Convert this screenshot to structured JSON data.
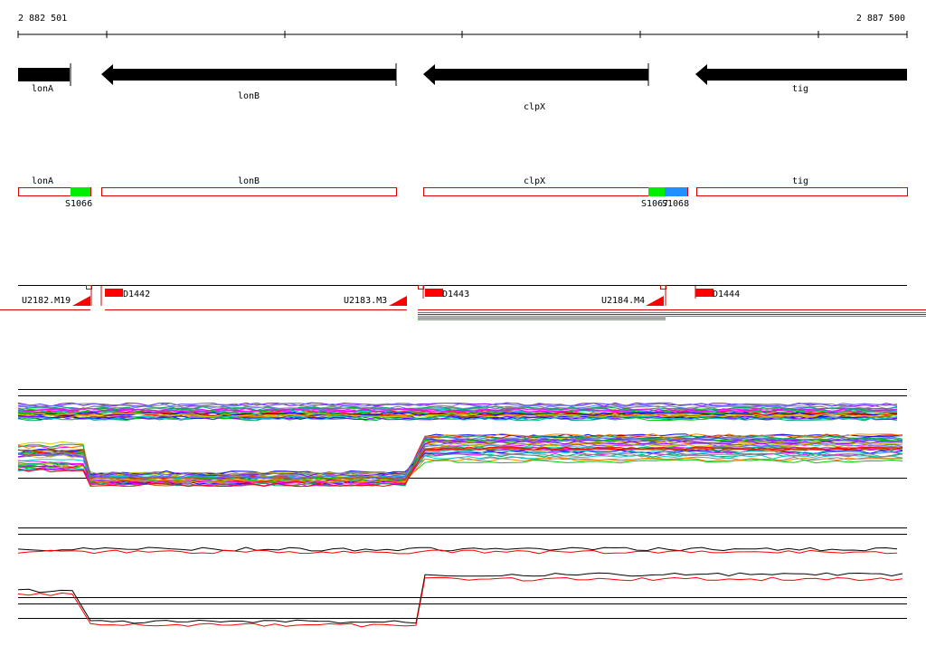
{
  "header": {
    "coord_start": "2 882 501",
    "coord_end": "2 887 500"
  },
  "genes": [
    {
      "name": "lonA"
    },
    {
      "name": "lonB"
    },
    {
      "name": "clpX"
    },
    {
      "name": "tig"
    }
  ],
  "features": [
    {
      "name": "S1066",
      "color": "#00ee00"
    },
    {
      "name": "S1067",
      "color": "#00ee00"
    },
    {
      "name": "S1068",
      "color": "#1e90ff"
    }
  ],
  "probes": [
    {
      "name": "U2182.M19"
    },
    {
      "name": "U2183.M3"
    },
    {
      "name": "U2184.M4"
    }
  ],
  "operons": [
    {
      "name": "D1442"
    },
    {
      "name": "D1443"
    },
    {
      "name": "D1444"
    }
  ],
  "colors": {
    "gene_arrow": "#000000",
    "feature_outline": "#dd0000",
    "operon_block": "#ff0000",
    "profile_palette": [
      "#ff0000",
      "#00cc00",
      "#0000ff",
      "#ff00ff",
      "#00cccc",
      "#cccc00",
      "#ff8800",
      "#8800ff",
      "#888888",
      "#00aa66",
      "#aa6600",
      "#6666ff"
    ]
  }
}
